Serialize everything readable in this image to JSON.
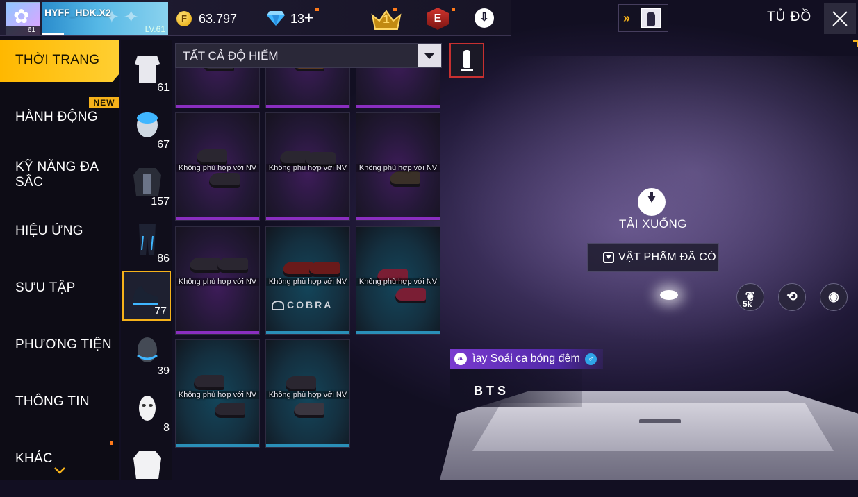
{
  "header": {
    "player_name": "HYFF_HDK.X2",
    "avatar_level": "61",
    "level_label": "LV.61",
    "coins": "63.797",
    "coin_glyph": "F",
    "diamonds": "13",
    "diamond_plus": "+",
    "rank_number": "1",
    "elite_badge": "E",
    "title": "TỦ ĐỒ",
    "accent_color": "#f6b21a"
  },
  "sidebar": {
    "items": [
      {
        "label": "THỜI TRANG",
        "active": true
      },
      {
        "label": "HÀNH ĐỘNG",
        "badge": "NEW"
      },
      {
        "label": "KỸ NĂNG ĐA SẮC"
      },
      {
        "label": "HIỆU ỨNG"
      },
      {
        "label": "SƯU TẬP"
      },
      {
        "label": "PHƯƠNG TIỆN"
      },
      {
        "label": "THÔNG TIN"
      },
      {
        "label": "KHÁC"
      }
    ]
  },
  "categories": [
    {
      "icon": "outfit-icon",
      "count": "61"
    },
    {
      "icon": "headwear-icon",
      "count": "67"
    },
    {
      "icon": "top-icon",
      "count": "157"
    },
    {
      "icon": "bottom-icon",
      "count": "86"
    },
    {
      "icon": "shoes-icon",
      "count": "77",
      "selected": true
    },
    {
      "icon": "mask-icon",
      "count": "39"
    },
    {
      "icon": "face-icon",
      "count": "8"
    },
    {
      "icon": "jacket-icon",
      "count": ""
    }
  ],
  "filter": {
    "selected": "TẤT CẢ ĐỘ HIẾM"
  },
  "items": [
    {
      "label": "",
      "rarity": "purple"
    },
    {
      "label": "",
      "rarity": "purple"
    },
    {
      "label": "",
      "rarity": "purple"
    },
    {
      "label": "Không phù hợp với NV",
      "rarity": "purple"
    },
    {
      "label": "Không phù hợp với NV",
      "rarity": "purple"
    },
    {
      "label": "Không phù hợp với NV",
      "rarity": "purple"
    },
    {
      "label": "Không phù hợp với NV",
      "rarity": "purple"
    },
    {
      "label": "Không phù hợp với NV",
      "rarity": "blue",
      "brand": "COBRA"
    },
    {
      "label": "Không phù hợp với NV",
      "rarity": "blue"
    },
    {
      "label": "Không phù hợp với NV",
      "rarity": "blue"
    },
    {
      "label": "Không phù hợp với NV",
      "rarity": "blue"
    }
  ],
  "preview": {
    "download_label": "TẢI XUỐNG",
    "owned_label": "VẬT PHẨM ĐÃ CÓ",
    "like_count": "5k",
    "character_name": "ìay Soái ca bóng đêm",
    "guild": "BTS",
    "gender_symbol": "♂"
  }
}
